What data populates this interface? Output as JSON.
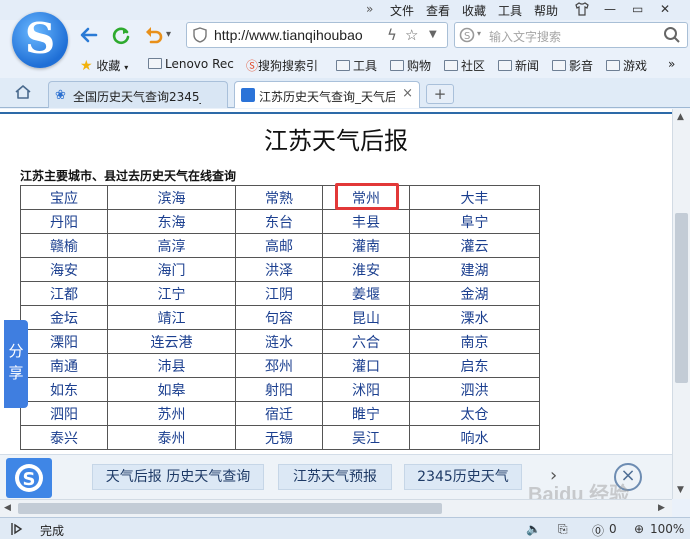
{
  "menu": {
    "chevron": "»",
    "items": [
      "文件",
      "查看",
      "收藏",
      "工具",
      "帮助"
    ]
  },
  "toolbar": {
    "url": "http://www.tianqihoubao",
    "search_placeholder": "输入文字搜索",
    "back_icon": "back-arrow-icon",
    "refresh_icon": "refresh-icon",
    "undo_icon": "undo-icon"
  },
  "bookmarks": {
    "fav_label": "收藏",
    "items": [
      "Lenovo Rec",
      "搜狗搜索引",
      "工具",
      "购物",
      "社区",
      "新闻",
      "影音",
      "游戏"
    ],
    "more": "»"
  },
  "tabs": [
    {
      "label": "全国历史天气查询2345_"
    },
    {
      "label": "江苏历史天气查询_天气后"
    }
  ],
  "page": {
    "title": "江苏天气后报",
    "subtitle": "江苏主要城市、县过去历史天气在线查询",
    "cities": [
      [
        "宝应",
        "滨海",
        "常熟",
        "常州",
        "大丰"
      ],
      [
        "丹阳",
        "东海",
        "东台",
        "丰县",
        "阜宁"
      ],
      [
        "赣榆",
        "高淳",
        "高邮",
        "灌南",
        "灌云"
      ],
      [
        "海安",
        "海门",
        "洪泽",
        "淮安",
        "建湖"
      ],
      [
        "江都",
        "江宁",
        "江阴",
        "姜堰",
        "金湖"
      ],
      [
        "金坛",
        "靖江",
        "句容",
        "昆山",
        "溧水"
      ],
      [
        "溧阳",
        "连云港",
        "涟水",
        "六合",
        "南京"
      ],
      [
        "南通",
        "沛县",
        "邳州",
        "灌口",
        "启东"
      ],
      [
        "如东",
        "如皋",
        "射阳",
        "沭阳",
        "泗洪"
      ],
      [
        "泗阳",
        "苏州",
        "宿迁",
        "睢宁",
        "太仓"
      ],
      [
        "泰兴",
        "泰州",
        "无锡",
        "吴江",
        "响水"
      ]
    ],
    "share_label_1": "分",
    "share_label_2": "享"
  },
  "adbar": {
    "buttons": [
      "天气后报 历史天气查询",
      "江苏天气预报",
      "2345历史天气"
    ],
    "more": "›",
    "close": "×"
  },
  "watermark": "Baidu 经验",
  "status": {
    "text": "完成",
    "zero": "0",
    "zoom": "100%"
  }
}
